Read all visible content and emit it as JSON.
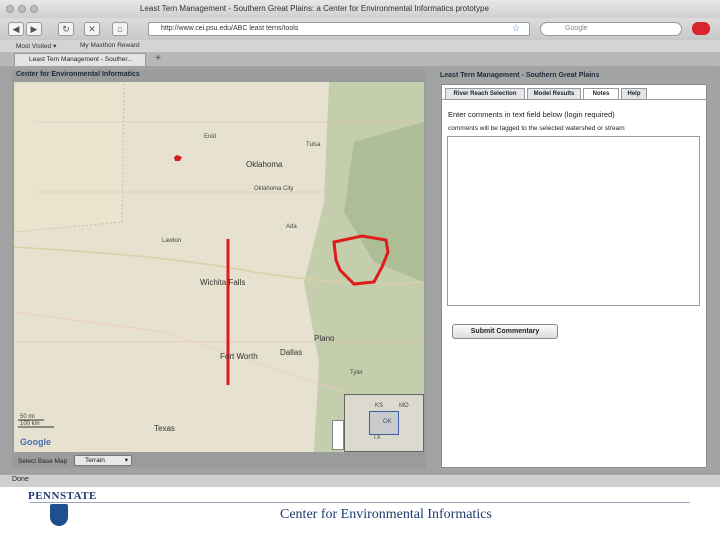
{
  "browser": {
    "window_title": "Least Tern Management - Southern Great Plains: a Center for Environmental Informatics prototype",
    "url": "http://www.cei.psu.edu/ABC least terns/tools",
    "search_placeholder": "Google",
    "bookmarks": [
      "Most Visited ▾",
      "My Maxthon Reward"
    ],
    "tab_label": "Least Tern Management - Souther...",
    "new_tab": "+",
    "status": "Done"
  },
  "map_panel": {
    "title": "Center for Environmental Informatics",
    "base_map_label": "Select Base Map",
    "base_map_value": "Terrain",
    "scale_top": "50 mi",
    "scale_bottom": "100 km",
    "attribution": "Google",
    "cities": {
      "oklahoma": "Oklahoma",
      "oklahoma_city": "Oklahoma City",
      "tulsa": "Tulsa",
      "wichita_falls": "Wichita Falls",
      "fort_worth": "Fort Worth",
      "dallas": "Dallas",
      "plano": "Plano",
      "texas": "Texas",
      "tyler": "Tyler",
      "lawton": "Lawton",
      "ada": "Ada",
      "enid": "Enid"
    },
    "overview_labels": [
      "KS",
      "MO",
      "OK",
      "TX"
    ]
  },
  "side_panel": {
    "title": "Least Tern Management - Southern Great Plains",
    "tabs": [
      {
        "label": "River Reach Selection"
      },
      {
        "label": "Model Results"
      },
      {
        "label": "Notes"
      },
      {
        "label": "Help"
      }
    ],
    "instructions": "Enter comments in text field below (login required)",
    "note": "comments will be tagged to the selected watershed or stream",
    "comment_value": "",
    "submit_label": "Submit Commentary"
  },
  "footer": {
    "logo_text": "PENNSTATE",
    "org_name": "Center for Environmental Informatics"
  },
  "colors": {
    "highlight": "#e01b1b",
    "footer_text": "#1c3a6e",
    "panel_bg": "#a1a3a3"
  }
}
